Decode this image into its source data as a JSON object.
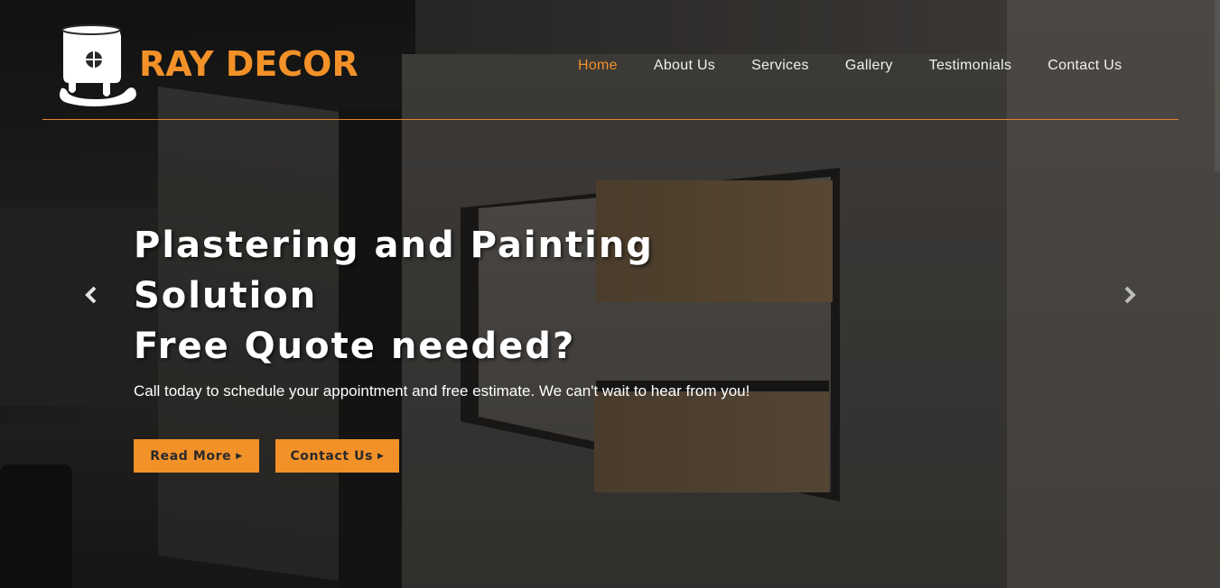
{
  "brand": {
    "name": "RAY DECOR",
    "accent": "#f39129"
  },
  "nav": {
    "items": [
      {
        "label": "Home",
        "active": true
      },
      {
        "label": "About Us",
        "active": false
      },
      {
        "label": "Services",
        "active": false
      },
      {
        "label": "Gallery",
        "active": false
      },
      {
        "label": "Testimonials",
        "active": false
      },
      {
        "label": "Contact Us",
        "active": false
      }
    ]
  },
  "slide": {
    "headline": [
      "Plastering and Painting",
      "Solution",
      "Free Quote needed?"
    ],
    "subtext": "Call today to schedule your appointment and free estimate. We can't wait to hear from you!",
    "buttons": {
      "read_more": "Read More",
      "contact_us": "Contact Us"
    }
  },
  "icons": {
    "prev": "chevron-left-icon",
    "next": "chevron-right-icon",
    "caret": "caret-right-icon",
    "logo": "paint-bucket-house-icon"
  }
}
